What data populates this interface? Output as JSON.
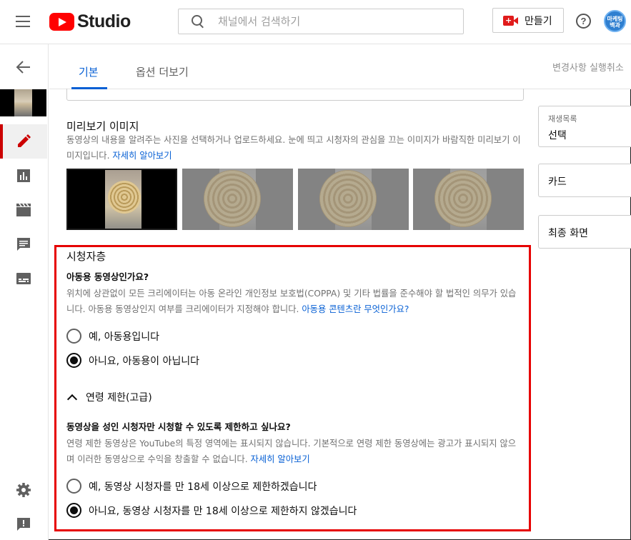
{
  "header": {
    "studio_label": "Studio",
    "search_placeholder": "채널에서 검색하기",
    "create_label": "만들기",
    "help_glyph": "?",
    "avatar_text_1": "마케팅",
    "avatar_text_2": "백과"
  },
  "tabs": {
    "basic": "기본",
    "more_options": "옵션 더보기",
    "undo": "변경사항 실행취소"
  },
  "thumbnail_section": {
    "title": "미리보기 이미지",
    "description": "동영상의 내용을 알려주는 사진을 선택하거나 업로드하세요. 눈에 띄고 시청자의 관심을 끄는 이미지가 바람직한 미리보기 이미지입니다.",
    "learn_more": "자세히 알아보기"
  },
  "audience": {
    "title": "시청자층",
    "question": "아동용 동영상인가요?",
    "description": "위치에 상관없이 모든 크리에이터는 아동 온라인 개인정보 보호법(COPPA) 및 기타 법률을 준수해야 할 법적인 의무가 있습니다. 아동용 동영상인지 여부를 크리에이터가 지정해야 합니다.",
    "link": "아동용 콘텐츠란 무엇인가요?",
    "option_yes": "예, 아동용입니다",
    "option_no": "아니요, 아동용이 아닙니다",
    "selected": "no"
  },
  "age_restriction": {
    "title": "연령 제한(고급)",
    "question": "동영상을 성인 시청자만 시청할 수 있도록 제한하고 싶나요?",
    "description": "연령 제한 동영상은 YouTube의 특정 영역에는 표시되지 않습니다. 기본적으로 연령 제한 동영상에는 광고가 표시되지 않으며 이러한 동영상으로 수익을 창출할 수 없습니다.",
    "learn_more": "자세히 알아보기",
    "option_yes": "예, 동영상 시청자를 만 18세 이상으로 제한하겠습니다",
    "option_no": "아니요, 동영상 시청자를 만 18세 이상으로 제한하지 않겠습니다",
    "selected": "no"
  },
  "right_panel": {
    "playlist_label": "재생목록",
    "playlist_value": "선택",
    "cards": "카드",
    "end_screen": "최종 화면"
  },
  "colors": {
    "brand_red": "#ff0000",
    "highlight_box": "#e60000",
    "link_blue": "#065fd4",
    "active_nav": "#cc0000"
  }
}
